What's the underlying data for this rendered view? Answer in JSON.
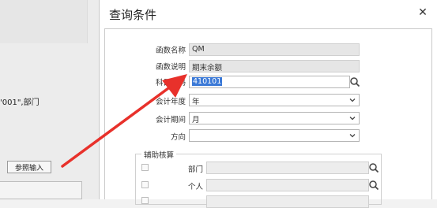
{
  "background": {
    "partial_text": "'001\",部门",
    "ref_button_label": "参照输入"
  },
  "dialog": {
    "title": "查询条件",
    "close_symbol": "✕",
    "fields": {
      "func_name": {
        "label": "函数名称",
        "value": "QM"
      },
      "func_desc": {
        "label": "函数说明",
        "value": "期末余额"
      },
      "account_code": {
        "label": "科目编码",
        "value": "410101"
      },
      "fiscal_year": {
        "label": "会计年度",
        "value": "年"
      },
      "fiscal_period": {
        "label": "会计期间",
        "value": "月"
      },
      "direction": {
        "label": "方向",
        "value": ""
      }
    },
    "aux": {
      "group_title": "辅助核算",
      "dept_label": "部门",
      "person_label": "个人"
    }
  },
  "icons": {
    "search": "search-icon",
    "dropdown": "chevron-down-icon",
    "close": "close-icon"
  },
  "colors": {
    "selection": "#3b79d7",
    "arrow": "#e8312b"
  }
}
